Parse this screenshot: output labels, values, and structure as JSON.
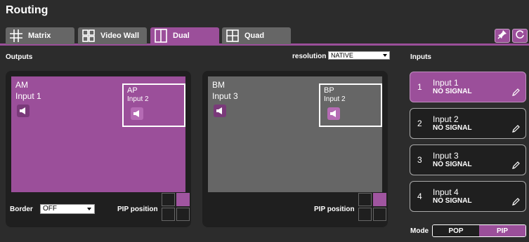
{
  "app": {
    "title": "Routing"
  },
  "tabs": [
    {
      "label": "Matrix",
      "icon": "matrix-grid-icon",
      "active": false
    },
    {
      "label": "Video Wall",
      "icon": "video-wall-icon",
      "active": false
    },
    {
      "label": "Dual",
      "icon": "dual-split-icon",
      "active": true
    },
    {
      "label": "Quad",
      "icon": "quad-split-icon",
      "active": false
    }
  ],
  "toolbar": {
    "pin_icon": "pin-icon",
    "refresh_icon": "refresh-icon"
  },
  "outputs": {
    "heading": "Outputs",
    "resolution_label": "resolution",
    "resolution_value": "NATIVE",
    "panels": [
      {
        "name": "AM",
        "input": "Input 1",
        "color": "#9b4f9a",
        "pip": {
          "name": "AP",
          "input": "Input 2"
        },
        "border_label": "Border",
        "border_value": "OFF",
        "pip_position_label": "PIP position"
      },
      {
        "name": "BM",
        "input": "Input 3",
        "color": "#666666",
        "pip": {
          "name": "BP",
          "input": "Input 2"
        },
        "pip_position_label": "PIP position"
      }
    ]
  },
  "inputs": {
    "heading": "Inputs",
    "items": [
      {
        "num": "1",
        "name": "Input 1",
        "status": "NO SIGNAL",
        "selected": true
      },
      {
        "num": "2",
        "name": "Input 2",
        "status": "NO SIGNAL",
        "selected": false
      },
      {
        "num": "3",
        "name": "Input 3",
        "status": "NO SIGNAL",
        "selected": false
      },
      {
        "num": "4",
        "name": "Input 4",
        "status": "NO SIGNAL",
        "selected": false
      }
    ]
  },
  "mode": {
    "label": "Mode",
    "options": [
      "POP",
      "PIP"
    ],
    "selected": "PIP"
  },
  "colors": {
    "accent": "#9b4f9a",
    "background": "#2c2c2c",
    "panel": "#1f1f1f"
  }
}
